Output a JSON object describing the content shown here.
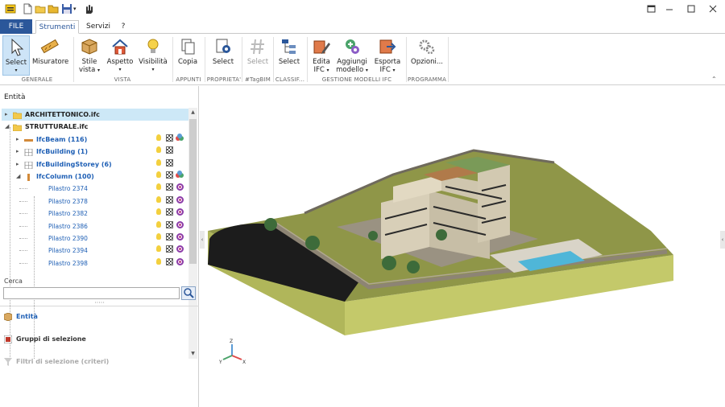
{
  "titlebar": {
    "quick_access": [
      "app-menu-icon",
      "new-file-icon",
      "open-folder-icon",
      "folder-icon",
      "save-icon",
      "dropdown-icon",
      "touch-mode-icon"
    ],
    "window_buttons": [
      "restore",
      "minimize",
      "maximize",
      "close"
    ]
  },
  "tabs": {
    "file": "FILE",
    "strumenti": "Strumenti",
    "servizi": "Servizi",
    "help": "?"
  },
  "ribbon": {
    "select": "Select",
    "misuratore": "Misuratore",
    "stile_vista": "Stile",
    "stile_vista_2": "vista",
    "aspetto": "Aspetto",
    "visibilita": "Visibilità",
    "copia": "Copia",
    "select_proprieta": "Select",
    "select_tagbim": "Select",
    "select_classif": "Select",
    "edita": "Edita",
    "edita_2": "IFC",
    "aggiungi": "Aggiungi",
    "aggiungi_2": "modello",
    "esporta": "Esporta",
    "esporta_2": "IFC",
    "opzioni": "Opzioni...",
    "groups": {
      "generale": "GENERALE",
      "vista": "VISTA",
      "appunti": "APPUNTI",
      "proprieta": "PROPRIETA'",
      "tagbim": "#TagBIM",
      "classif": "CLASSIF...",
      "gestione": "GESTIONE MODELLI IFC",
      "programma": "PROGRAMMA"
    }
  },
  "panel": {
    "title": "Entità",
    "tree": [
      {
        "label": "ARCHITETTONICO.ifc",
        "level": 0,
        "kind": "file"
      },
      {
        "label": "STRUTTURALE.ifc",
        "level": 0,
        "kind": "file"
      },
      {
        "label": "IfcBeam (116)",
        "level": 1,
        "kind": "beam"
      },
      {
        "label": "IfcBuilding (1)",
        "level": 1,
        "kind": "building"
      },
      {
        "label": "IfcBuildingStorey (6)",
        "level": 1,
        "kind": "storey"
      },
      {
        "label": "IfcColumn (100)",
        "level": 1,
        "kind": "column"
      },
      {
        "label": "Pilastro 2374",
        "level": 2,
        "kind": "leaf"
      },
      {
        "label": "Pilastro 2378",
        "level": 2,
        "kind": "leaf"
      },
      {
        "label": "Pilastro 2382",
        "level": 2,
        "kind": "leaf"
      },
      {
        "label": "Pilastro 2386",
        "level": 2,
        "kind": "leaf"
      },
      {
        "label": "Pilastro 2390",
        "level": 2,
        "kind": "leaf"
      },
      {
        "label": "Pilastro 2394",
        "level": 2,
        "kind": "leaf"
      },
      {
        "label": "Pilastro 2398",
        "level": 2,
        "kind": "leaf"
      }
    ],
    "search_label": "Cerca",
    "search_value": "",
    "nav": {
      "entita": "Entità",
      "gruppi": "Gruppi di selezione",
      "filtri": "Filtri di selezione (criteri)"
    }
  },
  "viewport": {
    "axis_labels": [
      "X",
      "Y",
      "Z"
    ],
    "colors": {
      "ground_top": "#8a9148",
      "ground_side": "#b4ba5c",
      "road": "#1a1a1a",
      "wall": "#8a8a7a",
      "building": "#d8cfb8",
      "pool": "#4fb6d8"
    }
  }
}
